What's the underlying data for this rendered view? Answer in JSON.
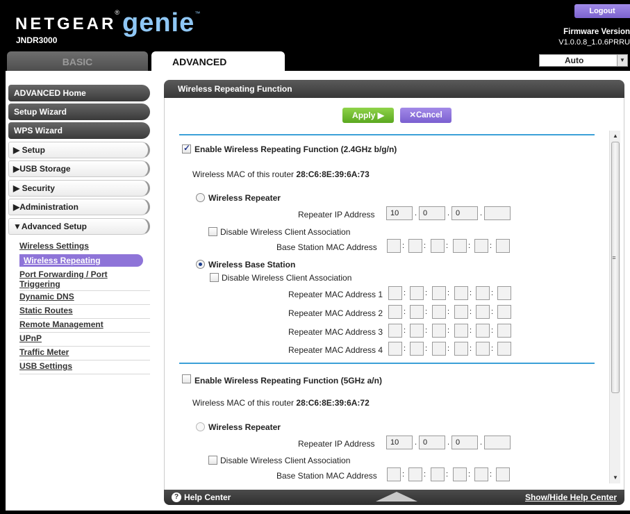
{
  "header": {
    "brand": "NETGEAR",
    "brand_mark": "®",
    "product": "genie",
    "product_mark": "™",
    "model": "JNDR3000",
    "logout_label": "Logout",
    "firmware_label": "Firmware Version",
    "firmware_value": "V1.0.0.8_1.0.6PRRU",
    "tabs": {
      "basic": "BASIC",
      "advanced": "ADVANCED"
    },
    "language": "Auto"
  },
  "sidebar": {
    "buttons": [
      "ADVANCED Home",
      "Setup Wizard",
      "WPS Wizard"
    ],
    "sections": [
      "▶ Setup",
      "▶USB Storage",
      "▶ Security",
      "▶Administration",
      "▼Advanced Setup"
    ],
    "items": [
      "Wireless Settings",
      "Wireless Repeating",
      "Port Forwarding / Port Triggering",
      "Dynamic DNS",
      "Static Routes",
      "Remote Management",
      "UPnP",
      "Traffic Meter",
      "USB Settings"
    ],
    "active_item": "Wireless Repeating"
  },
  "panel": {
    "title": "Wireless Repeating Function",
    "apply_label": "Apply ▶",
    "cancel_label": "✕Cancel",
    "help_label": "Help Center",
    "show_hide_label": "Show/Hide Help Center"
  },
  "band24": {
    "enable_label": "Enable Wireless Repeating Function (2.4GHz b/g/n)",
    "enabled": true,
    "mac_label": "Wireless MAC of this router",
    "mac_value": "28:C6:8E:39:6A:73",
    "repeater_label": "Wireless Repeater",
    "repeater_ip_label": "Repeater IP Address",
    "repeater_ip": [
      "10",
      "0",
      "0",
      ""
    ],
    "disable_assoc_label": "Disable Wireless Client Association",
    "base_mac_label": "Base Station MAC Address",
    "base_station_label": "Wireless Base Station",
    "mode": "Wireless Base Station",
    "repeater_mac_labels": [
      "Repeater MAC Address 1",
      "Repeater MAC Address 2",
      "Repeater MAC Address 3",
      "Repeater MAC Address 4"
    ]
  },
  "band5": {
    "enable_label": "Enable Wireless Repeating Function (5GHz a/n)",
    "enabled": false,
    "mac_label": "Wireless MAC of this router",
    "mac_value": "28:C6:8E:39:6A:72",
    "repeater_label": "Wireless Repeater",
    "repeater_ip_label": "Repeater IP Address",
    "repeater_ip": [
      "10",
      "0",
      "0",
      ""
    ],
    "disable_assoc_label": "Disable Wireless Client Association",
    "base_mac_label": "Base Station MAC Address"
  },
  "colors": {
    "accent": "#8e74d8",
    "apply": "#6cbb2c",
    "divider": "#3ba0d8",
    "genie": "#8fc7f5"
  }
}
